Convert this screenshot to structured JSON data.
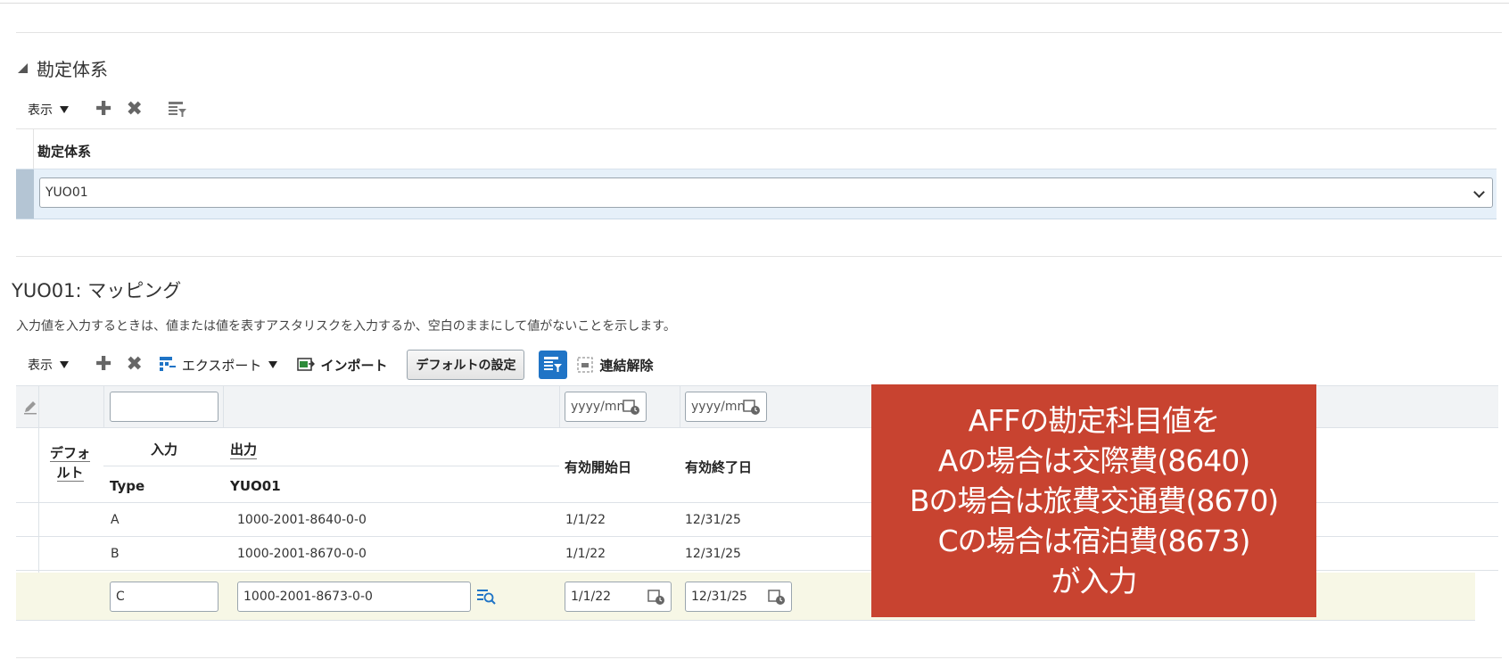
{
  "section1": {
    "title": "勘定体系",
    "toolbar": {
      "view_label": "表示"
    },
    "table": {
      "column_header": "勘定体系",
      "selected_value": "YUO01"
    }
  },
  "section2": {
    "title": "YUO01: マッピング",
    "description": "入力値を入力するときは、値または値を表すアスタリスクを入力するか、空白のままにして値がないことを示します。",
    "toolbar": {
      "view_label": "表示",
      "export_label": "エクスポート",
      "import_label": "インポート",
      "default_button": "デフォルトの設定",
      "unlink_label": "連結解除"
    },
    "filters": {
      "date_placeholder_start": "yyyy/mn",
      "date_placeholder_end": "yyyy/mn"
    },
    "headers": {
      "default": "デフォ\nルト",
      "default_line1": "デフォ",
      "default_line2": "ルト",
      "input": "入力",
      "output": "出力",
      "input_sub": "Type",
      "output_sub": "YUO01",
      "start_date": "有効開始日",
      "end_date": "有効終了日"
    },
    "rows": [
      {
        "type": "A",
        "output": "1000-2001-8640-0-0",
        "start": "1/1/22",
        "end": "12/31/25"
      },
      {
        "type": "B",
        "output": "1000-2001-8670-0-0",
        "start": "1/1/22",
        "end": "12/31/25"
      },
      {
        "type": "C",
        "output": "1000-2001-8673-0-0",
        "start": "1/1/22",
        "end": "12/31/25"
      }
    ]
  },
  "callout": {
    "lines": [
      "AFFの勘定科目値を",
      "Aの場合は交際費(8640)",
      "Bの場合は旅費交通費(8670)",
      "Cの場合は宿泊費(8673)",
      "が入力"
    ],
    "color": "#c84330"
  }
}
